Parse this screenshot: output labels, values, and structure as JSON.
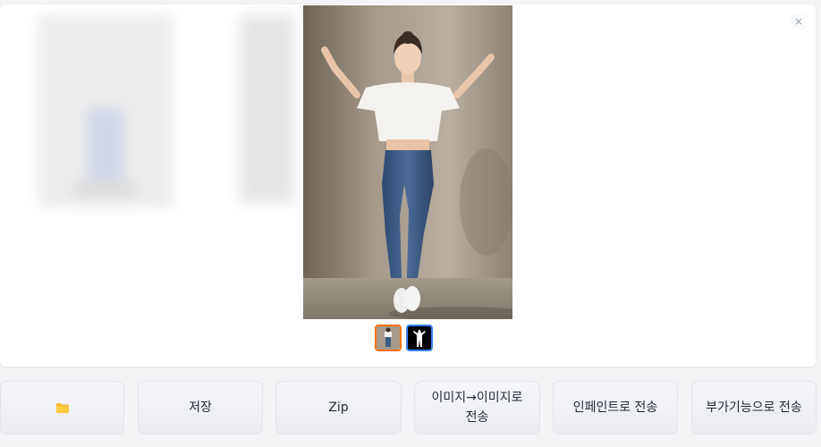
{
  "gallery": {
    "close_label": "×"
  },
  "actions": {
    "folder_icon": "folder-icon",
    "folder_label": "📁",
    "save_label": "저장",
    "zip_label": "Zip",
    "img2img_label": "이미지→이미지로 전송",
    "inpaint_label": "인페인트로 전송",
    "extras_label": "부가기능으로 전송"
  },
  "colors": {
    "selected_thumb_border": "#f97316",
    "thumb_border": "#3b82f6",
    "folder": "#f5b82e"
  }
}
